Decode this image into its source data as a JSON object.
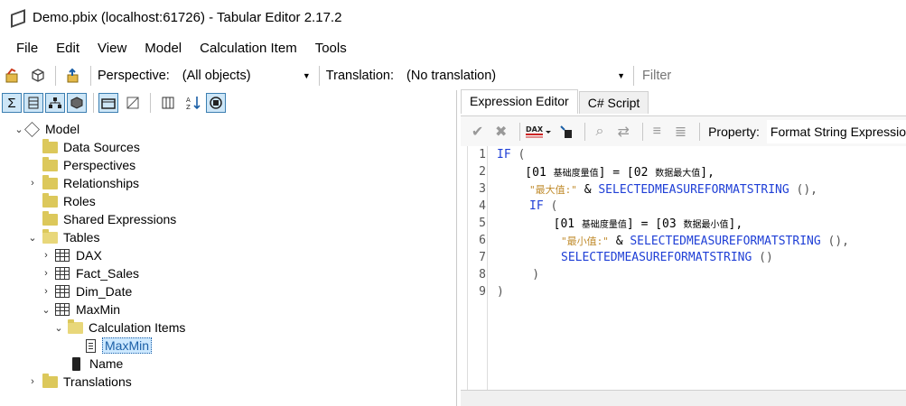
{
  "window": {
    "title": "Demo.pbix (localhost:61726) - Tabular Editor 2.17.2"
  },
  "menu": [
    {
      "label": "File"
    },
    {
      "label": "Edit"
    },
    {
      "label": "View"
    },
    {
      "label": "Model"
    },
    {
      "label": "Calculation Item"
    },
    {
      "label": "Tools"
    }
  ],
  "toolbar": {
    "perspective_label": "Perspective:",
    "perspective_value": "(All objects)",
    "translation_label": "Translation:",
    "translation_value": "(No translation)",
    "filter_placeholder": "Filter"
  },
  "tree": {
    "model": "Model",
    "data_sources": "Data Sources",
    "perspectives": "Perspectives",
    "relationships": "Relationships",
    "roles": "Roles",
    "shared_expressions": "Shared Expressions",
    "tables": "Tables",
    "dax": "DAX",
    "fact_sales": "Fact_Sales",
    "dim_date": "Dim_Date",
    "maxmin": "MaxMin",
    "calculation_items": "Calculation Items",
    "maxmin_item": "MaxMin",
    "name": "Name",
    "translations": "Translations"
  },
  "editor": {
    "tab_expression": "Expression Editor",
    "tab_script": "C# Script",
    "property_label": "Property:",
    "property_value": "Format String Expression",
    "line_numbers": [
      "1",
      "2",
      "3",
      "4",
      "5",
      "6",
      "7",
      "8",
      "9"
    ],
    "code": {
      "l1_kw": "IF",
      "l1_rest": " (",
      "l2_a": "    [01 ",
      "l2_cjk1": "基础度量值",
      "l2_b": "] = [02 ",
      "l2_cjk2": "数据最大值",
      "l2_c": "],",
      "l3_str": "\"最大值:\"",
      "l3_b": " & ",
      "l3_fn": "SELECTEDMEASUREFORMATSTRING",
      "l3_c": " (),",
      "l4_kw": "IF",
      "l4_rest": " (",
      "l5_a": "        [01 ",
      "l5_cjk1": "基础度量值",
      "l5_b": "] = [03 ",
      "l5_cjk2": "数据最小值",
      "l5_c": "],",
      "l6_str": "\"最小值:\"",
      "l6_b": " & ",
      "l6_fn": "SELECTEDMEASUREFORMATSTRING",
      "l6_c": " (),",
      "l7_fn": "SELECTEDMEASUREFORMATSTRING",
      "l7_c": " ()",
      "l8": "    )",
      "l9": ")"
    }
  },
  "colors": {
    "keyword": "#1f3fd6",
    "string": "#c08b2c",
    "folder": "#dcc85b",
    "selection": "#cce8ff"
  }
}
